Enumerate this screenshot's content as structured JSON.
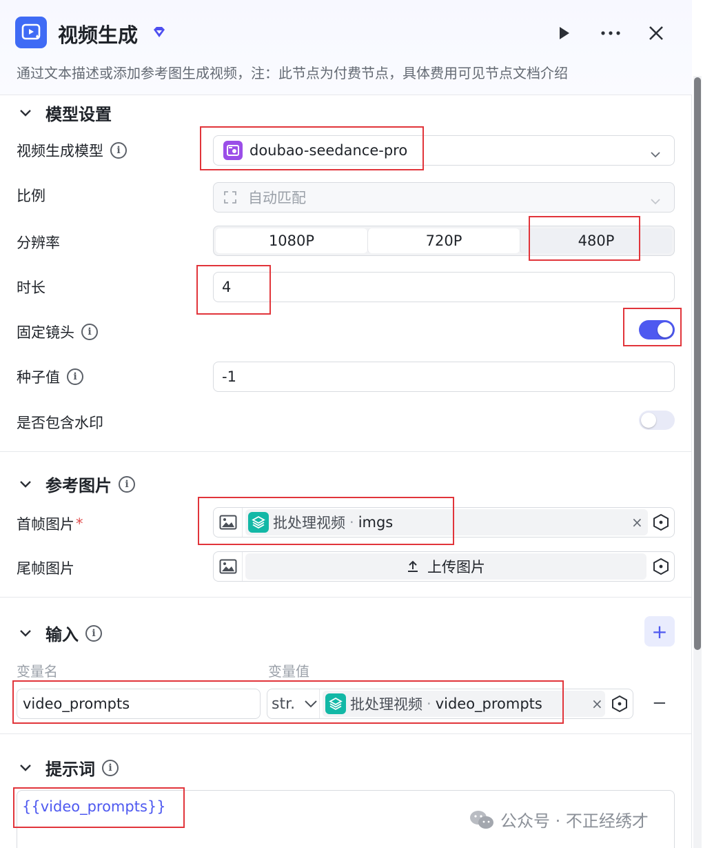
{
  "header": {
    "title": "视频生成",
    "description": "通过文本描述或添加参考图生成视频，注：此节点为付费节点，具体费用可见节点文档介绍"
  },
  "model_section": {
    "title": "模型设置",
    "model_label": "视频生成模型",
    "model_value": "doubao-seedance-pro",
    "ratio_label": "比例",
    "ratio_value": "自动匹配",
    "resolution_label": "分辨率",
    "resolutions": [
      "1080P",
      "720P",
      "480P"
    ],
    "resolution_selected": "480P",
    "duration_label": "时长",
    "duration_value": "4",
    "fixed_camera_label": "固定镜头",
    "fixed_camera_on": true,
    "seed_label": "种子值",
    "seed_value": "-1",
    "watermark_label": "是否包含水印",
    "watermark_on": false
  },
  "reference_section": {
    "title": "参考图片",
    "first_frame_label": "首帧图片",
    "required_mark": "*",
    "first_frame_node": "批处理视频",
    "first_frame_dot": "·",
    "first_frame_var": "imgs",
    "last_frame_label": "尾帧图片",
    "upload_label": "上传图片"
  },
  "input_section": {
    "title": "输入",
    "col_name": "变量名",
    "col_value": "变量值",
    "var_name": "video_prompts",
    "var_type": "str.",
    "ref_node": "批处理视频",
    "ref_dot": "·",
    "ref_var": "video_prompts",
    "add_symbol": "+",
    "remove_symbol": "−",
    "clear_symbol": "×"
  },
  "prompt_section": {
    "title": "提示词",
    "content": "{{video_prompts}}"
  },
  "watermark_overlay": {
    "text": "公众号 · 不正经绣才"
  },
  "colors": {
    "accent": "#4e59f0",
    "node_icon": "#3f6bf5",
    "ref_badge": "#13b8a6",
    "highlight_box": "#e1343a"
  }
}
